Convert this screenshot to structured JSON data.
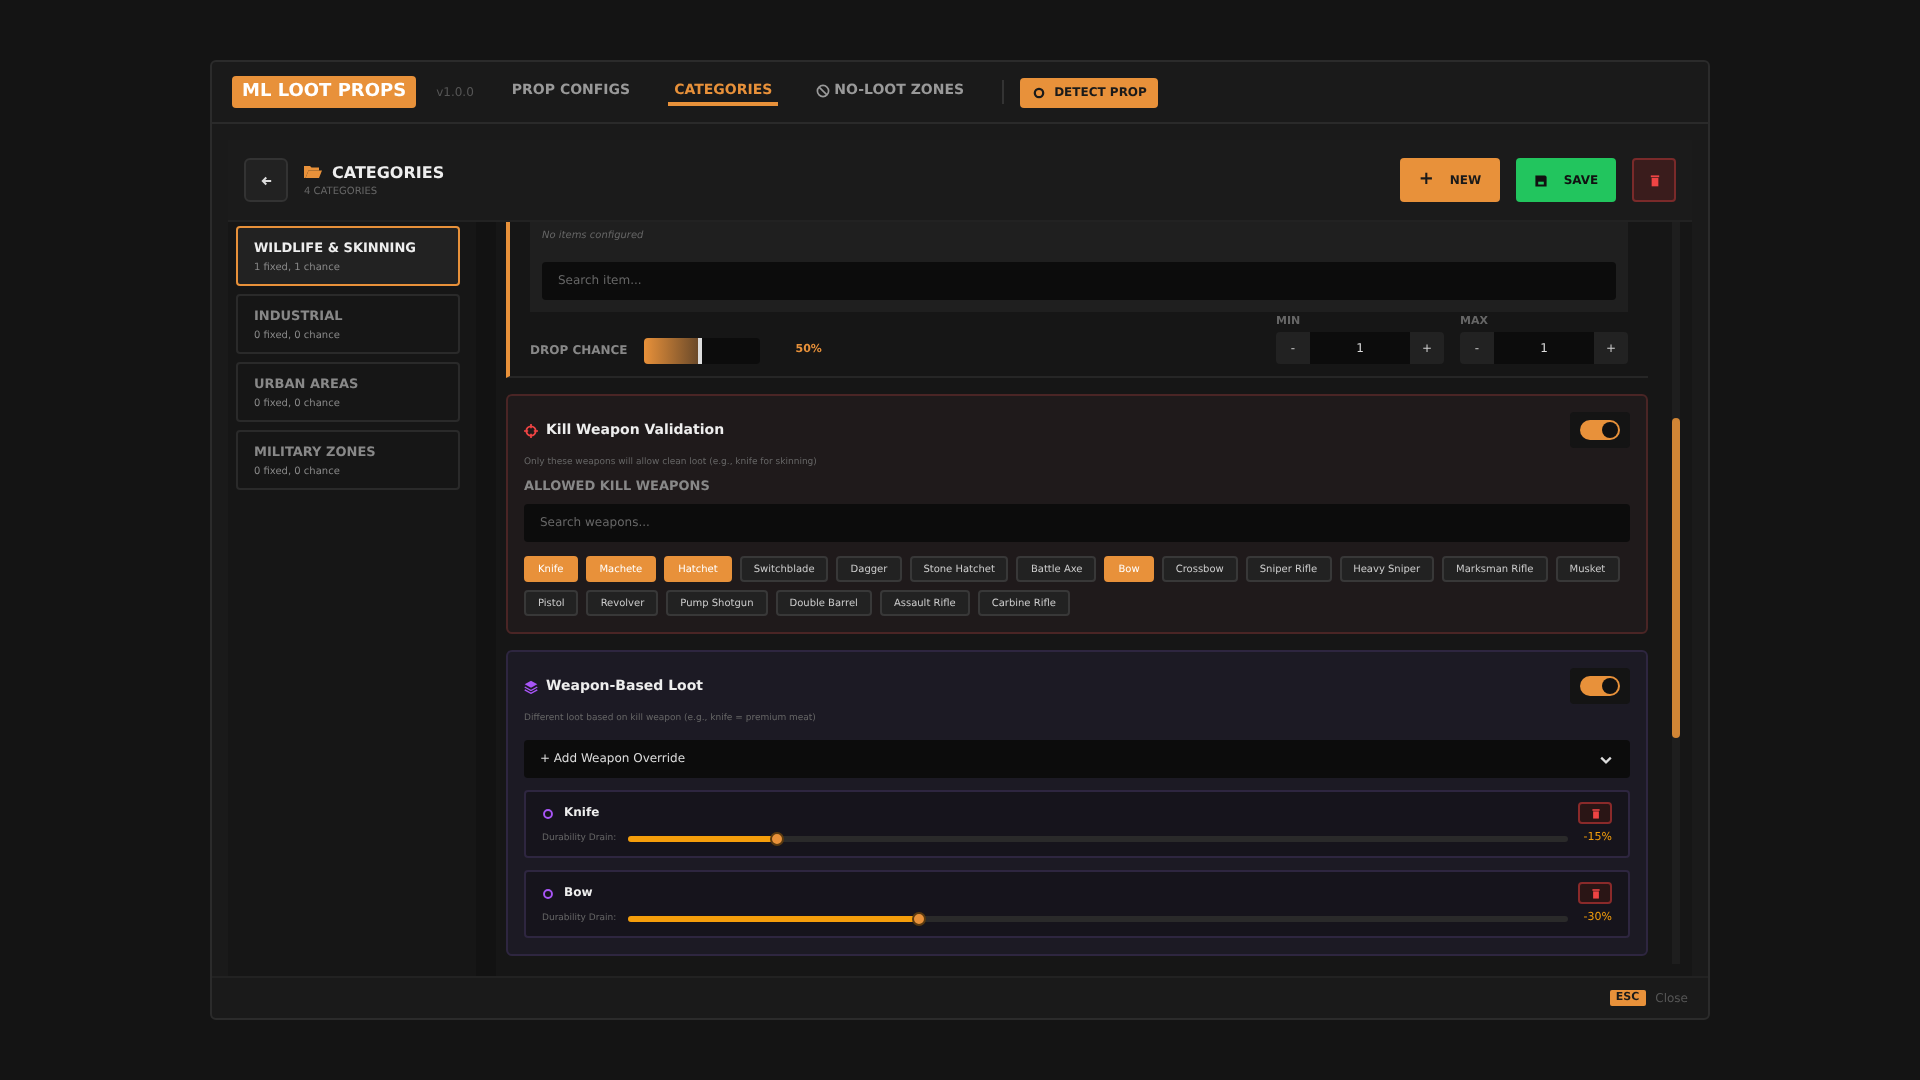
{
  "app": {
    "logo": "ML LOOT PROPS",
    "version": "v1.0.0"
  },
  "tabs": [
    {
      "label": "PROP CONFIGS",
      "selected": false,
      "icon": false
    },
    {
      "label": "CATEGORIES",
      "selected": true,
      "icon": false
    },
    {
      "label": "NO-LOOT ZONES",
      "selected": false,
      "icon": true
    }
  ],
  "detect_button": "DETECT PROP",
  "header": {
    "title": "CATEGORIES",
    "subtitle": "4 CATEGORIES",
    "new_icon": "+",
    "new_button": "NEW",
    "save_button": "SAVE"
  },
  "sidebar": {
    "items": [
      {
        "name": "WILDLIFE & SKINNING",
        "counts": "1 fixed, 1 chance",
        "selected": true
      },
      {
        "name": "INDUSTRIAL",
        "counts": "0 fixed, 0 chance",
        "selected": false
      },
      {
        "name": "URBAN AREAS",
        "counts": "0 fixed, 0 chance",
        "selected": false
      },
      {
        "name": "MILITARY ZONES",
        "counts": "0 fixed, 0 chance",
        "selected": false
      }
    ]
  },
  "items_section": {
    "empty_note": "No items configured",
    "search_placeholder": "Search item...",
    "drop_chance_label": "DROP CHANCE",
    "drop_chance": {
      "level": 0.5
    },
    "drop_chance_reading": "50%",
    "min": {
      "label": "MIN",
      "value": "1",
      "minus": "-",
      "plus": "+"
    },
    "max": {
      "label": "MAX",
      "value": "1",
      "minus": "-",
      "plus": "+"
    }
  },
  "kill_validation": {
    "title": "Kill Weapon Validation",
    "on": true,
    "description": "Only these weapons will allow clean loot (e.g., knife for skinning)",
    "list_label": "ALLOWED KILL WEAPONS",
    "search_placeholder": "Search weapons...",
    "weapons": [
      {
        "label": "Knife",
        "selected": true
      },
      {
        "label": "Machete",
        "selected": true
      },
      {
        "label": "Hatchet",
        "selected": true
      },
      {
        "label": "Switchblade",
        "selected": false
      },
      {
        "label": "Dagger",
        "selected": false
      },
      {
        "label": "Stone Hatchet",
        "selected": false
      },
      {
        "label": "Battle Axe",
        "selected": false
      },
      {
        "label": "Bow",
        "selected": true
      },
      {
        "label": "Crossbow",
        "selected": false
      },
      {
        "label": "Sniper Rifle",
        "selected": false
      },
      {
        "label": "Heavy Sniper",
        "selected": false
      },
      {
        "label": "Marksman Rifle",
        "selected": false
      },
      {
        "label": "Musket",
        "selected": false
      },
      {
        "label": "Pistol",
        "selected": false
      },
      {
        "label": "Revolver",
        "selected": false
      },
      {
        "label": "Pump Shotgun",
        "selected": false
      },
      {
        "label": "Double Barrel",
        "selected": false
      },
      {
        "label": "Assault Rifle",
        "selected": false
      },
      {
        "label": "Carbine Rifle",
        "selected": false
      }
    ]
  },
  "weapon_loot": {
    "title": "Weapon-Based Loot",
    "on": true,
    "description": "Different loot based on kill weapon (e.g., knife = premium meat)",
    "add_override": "+ Add Weapon Override",
    "overrides": [
      {
        "name": "Knife",
        "slider_label": "Durability Drain:",
        "level": 0.16,
        "reading": "-15%"
      },
      {
        "name": "Bow",
        "slider_label": "Durability Drain:",
        "level": 0.31,
        "reading": "-30%"
      }
    ]
  },
  "footer": {
    "key": "ESC",
    "label": "Close"
  }
}
